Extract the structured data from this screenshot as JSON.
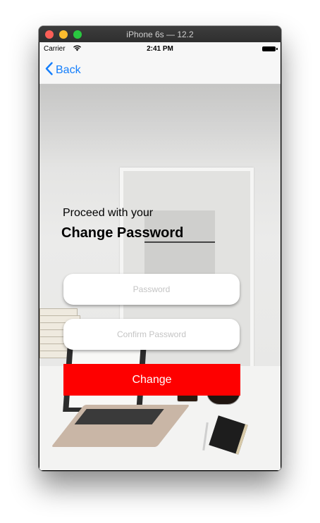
{
  "window": {
    "title": "iPhone 6s — 12.2"
  },
  "status_bar": {
    "carrier": "Carrier",
    "time": "2:41 PM"
  },
  "nav": {
    "back_label": "Back"
  },
  "form": {
    "intro": "Proceed with your",
    "heading": "Change Password",
    "password_placeholder": "Password",
    "confirm_placeholder": "Confirm Password",
    "submit_label": "Change"
  },
  "colors": {
    "accent_blue": "#147efb",
    "button_red": "#fe0000"
  },
  "icons": [
    "close-icon",
    "minimize-icon",
    "zoom-icon",
    "wifi-icon",
    "battery-icon",
    "chevron-left-icon"
  ]
}
